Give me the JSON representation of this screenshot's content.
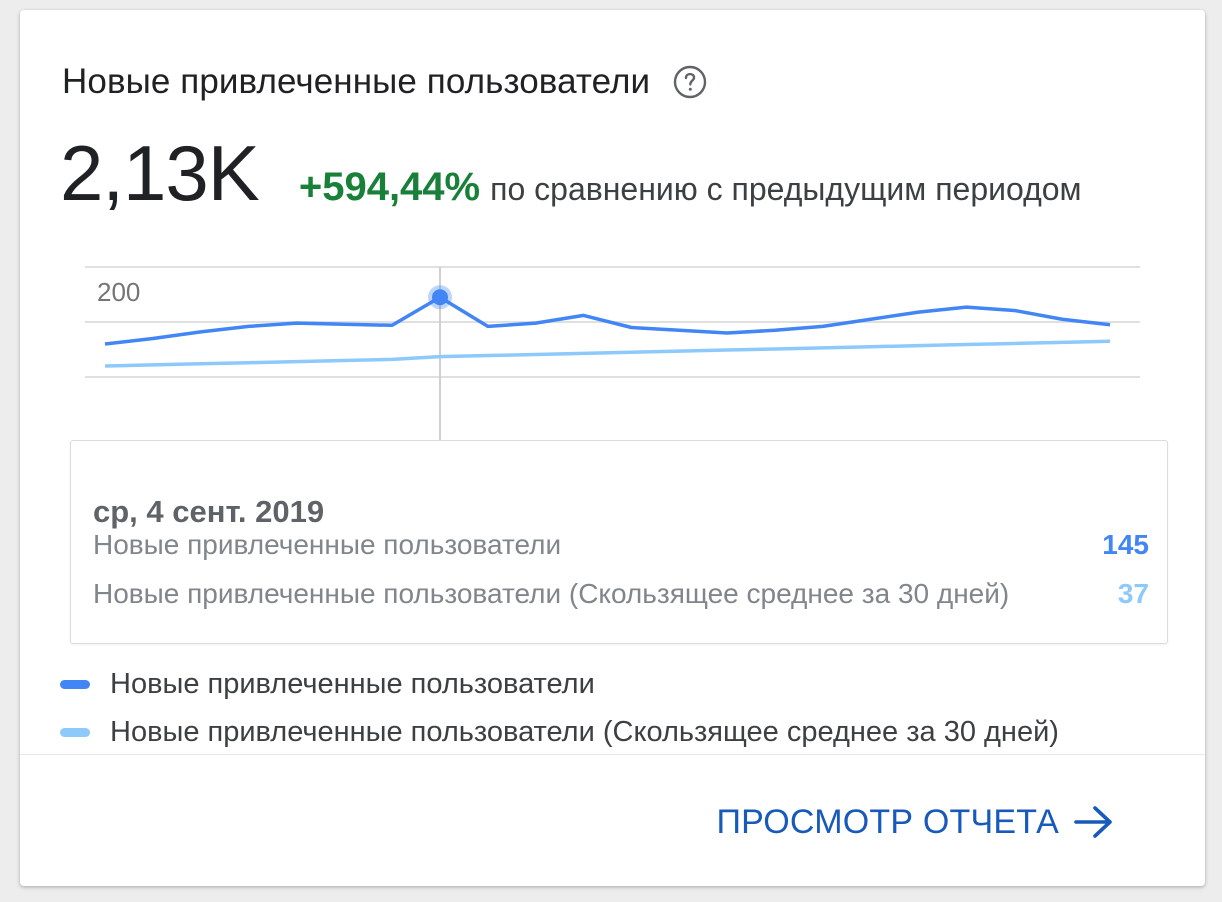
{
  "card": {
    "title": "Новые привлеченные пользователи",
    "help_icon": "help-circle-icon",
    "metric_value": "2,13K",
    "metric_change": "+594,44%",
    "metric_caption": "по сравнению с предыдущим периодом"
  },
  "colors": {
    "primary_series": "#4285f4",
    "moving_average_series": "#8ec9fb",
    "positive_change": "#188038",
    "link": "#185abc"
  },
  "chart_data": {
    "type": "line",
    "title": "",
    "xlabel": "",
    "ylabel": "",
    "ylim": [
      0,
      200
    ],
    "yticks": [
      200
    ],
    "grid": true,
    "x": [
      1,
      2,
      3,
      4,
      5,
      6,
      7,
      8,
      9,
      10,
      11,
      12,
      13,
      14,
      15,
      16,
      17,
      18,
      19,
      20,
      21,
      22
    ],
    "series": [
      {
        "name": "Новые привлеченные пользователи",
        "values": [
          60,
          70,
          82,
          92,
          98,
          96,
          94,
          145,
          92,
          98,
          112,
          90,
          85,
          80,
          85,
          92,
          105,
          118,
          127,
          121,
          105,
          95
        ],
        "highlight_index": 7
      },
      {
        "name": "Новые привлеченные пользователи (Скользящее среднее за 30 дней)",
        "values": [
          20,
          22,
          24,
          26,
          28,
          30,
          32,
          37,
          39,
          41,
          43,
          45,
          47,
          49,
          51,
          53,
          55,
          57,
          59,
          61,
          63,
          65
        ]
      }
    ]
  },
  "tooltip": {
    "date": "ср, 4 сент. 2019",
    "rows": [
      {
        "label": "Новые привлеченные пользователи",
        "value": "145"
      },
      {
        "label": "Новые привлеченные пользователи (Скользящее среднее за 30 дней)",
        "value": "37"
      }
    ]
  },
  "legend": [
    {
      "label": "Новые привлеченные пользователи"
    },
    {
      "label": "Новые привлеченные пользователи (Скользящее среднее за 30 дней)"
    }
  ],
  "footer": {
    "report_link_label": "ПРОСМОТР ОТЧЕТА",
    "arrow_icon": "arrow-right-icon"
  }
}
